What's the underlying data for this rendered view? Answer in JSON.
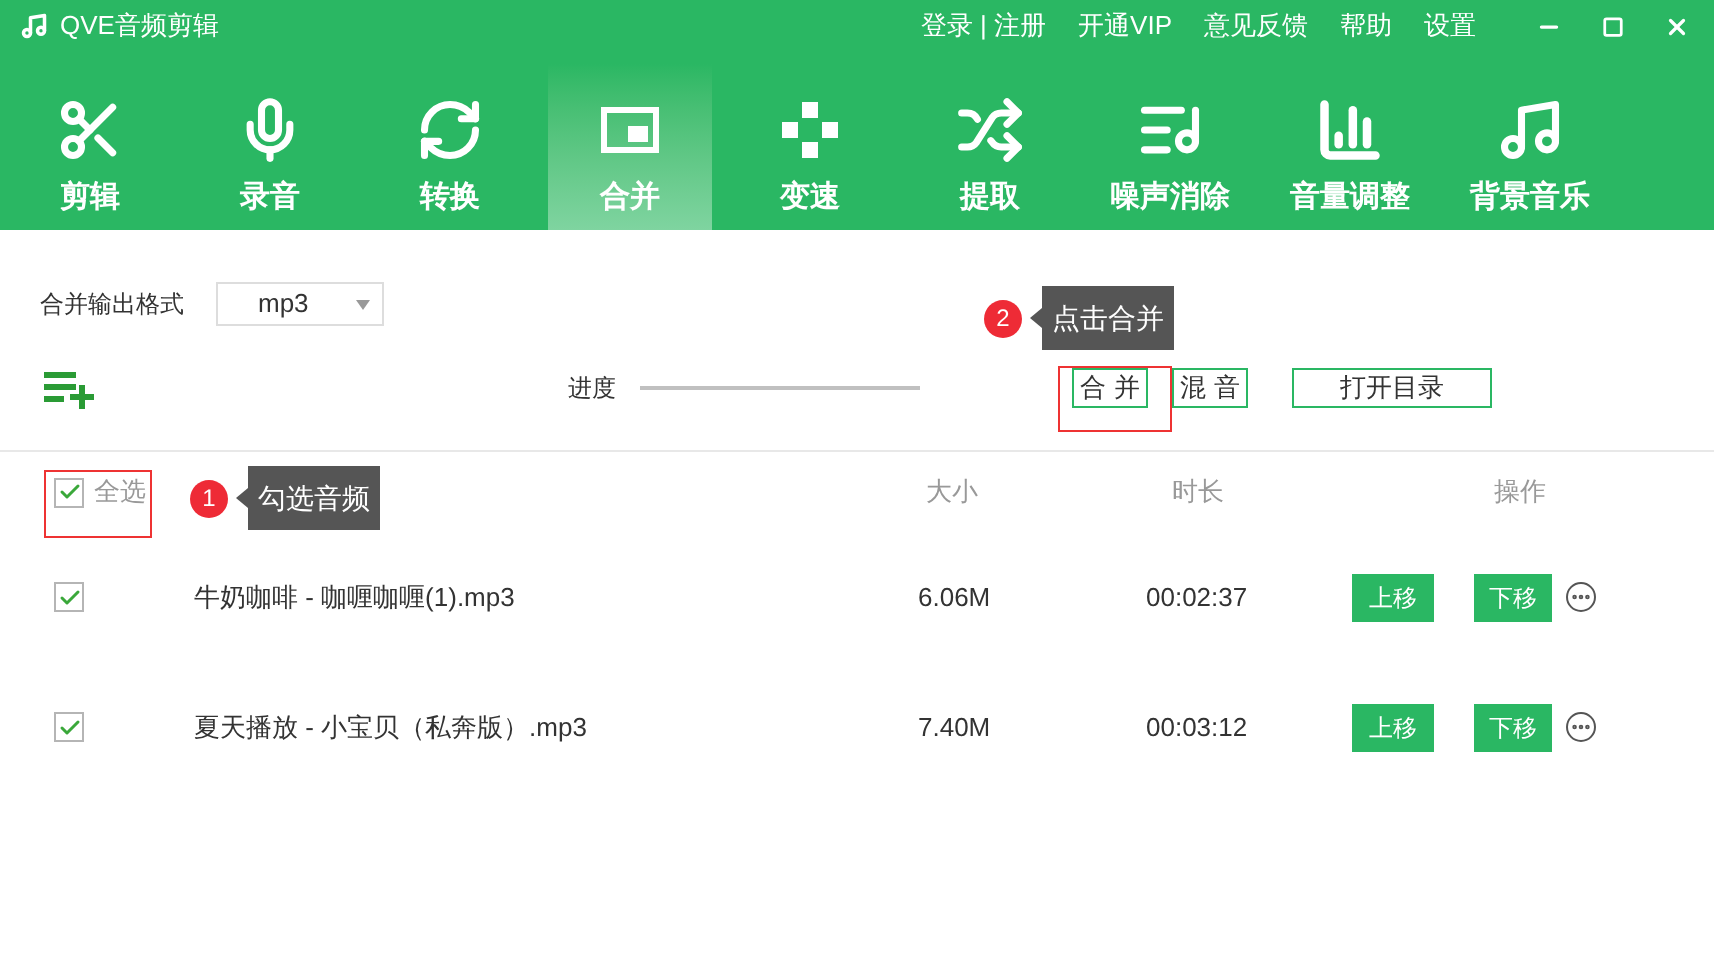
{
  "window": {
    "title": "QVE音频剪辑",
    "links": [
      "登录 | 注册",
      "开通VIP",
      "意见反馈",
      "帮助",
      "设置"
    ]
  },
  "tabs": [
    {
      "label": "剪辑",
      "selected": false
    },
    {
      "label": "录音",
      "selected": false
    },
    {
      "label": "转换",
      "selected": false
    },
    {
      "label": "合并",
      "selected": true
    },
    {
      "label": "变速",
      "selected": false
    },
    {
      "label": "提取",
      "selected": false
    },
    {
      "label": "噪声消除",
      "selected": false
    },
    {
      "label": "音量调整",
      "selected": false
    },
    {
      "label": "背景音乐",
      "selected": false
    }
  ],
  "format": {
    "label": "合并输出格式",
    "value": "mp3"
  },
  "progress": {
    "label": "进度"
  },
  "actions": [
    "合 并",
    "混 音",
    "打开目录"
  ],
  "table": {
    "select_all": {
      "label": "全选",
      "checked": true
    },
    "columns": [
      "大小",
      "时长",
      "操作"
    ],
    "rows": [
      {
        "name": "牛奶咖啡 - 咖喱咖喱(1).mp3",
        "size": "6.06M",
        "duration": "00:02:37",
        "checked": true,
        "up": "上移",
        "down": "下移"
      },
      {
        "name": "夏天播放 - 小宝贝（私奔版）.mp3",
        "size": "7.40M",
        "duration": "00:03:12",
        "checked": true,
        "up": "上移",
        "down": "下移"
      }
    ]
  },
  "annotations": [
    {
      "number": "1",
      "text": "勾选音频"
    },
    {
      "number": "2",
      "text": "点击合并"
    }
  ]
}
